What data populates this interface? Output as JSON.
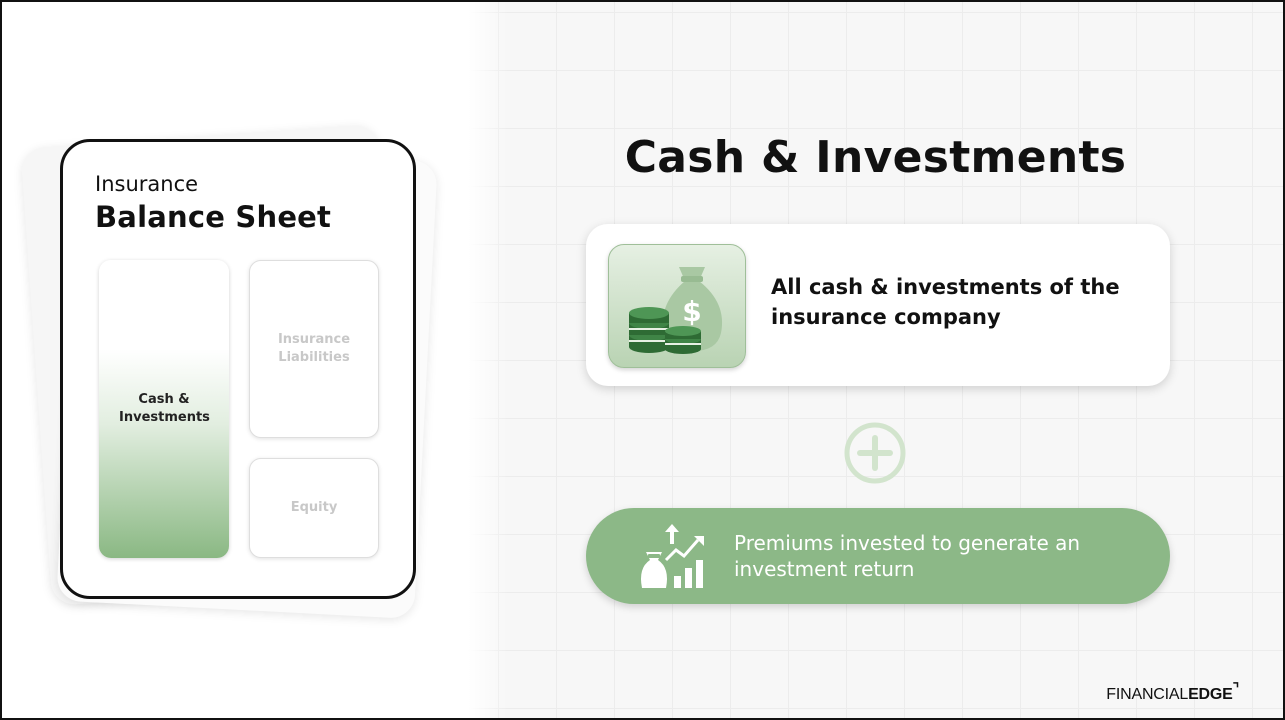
{
  "balance_sheet": {
    "subtitle": "Insurance",
    "title": "Balance Sheet",
    "cash_label": "Cash & Investments",
    "liabilities_label": "Insurance Liabilities",
    "equity_label": "Equity"
  },
  "main": {
    "title": "Cash & Investments",
    "info_text": "All cash & investments of the insurance company",
    "pill_text": "Premiums invested to generate an investment return"
  },
  "icons": {
    "money": "money-bag-coins-icon",
    "plus": "plus-circle-icon",
    "invest": "investment-growth-icon"
  },
  "colors": {
    "accent_green": "#8cb887",
    "dark_green": "#2e6b34",
    "light_green": "#cfe2ca"
  },
  "brand": {
    "light": "FINANCIAL",
    "bold": "EDGE"
  }
}
